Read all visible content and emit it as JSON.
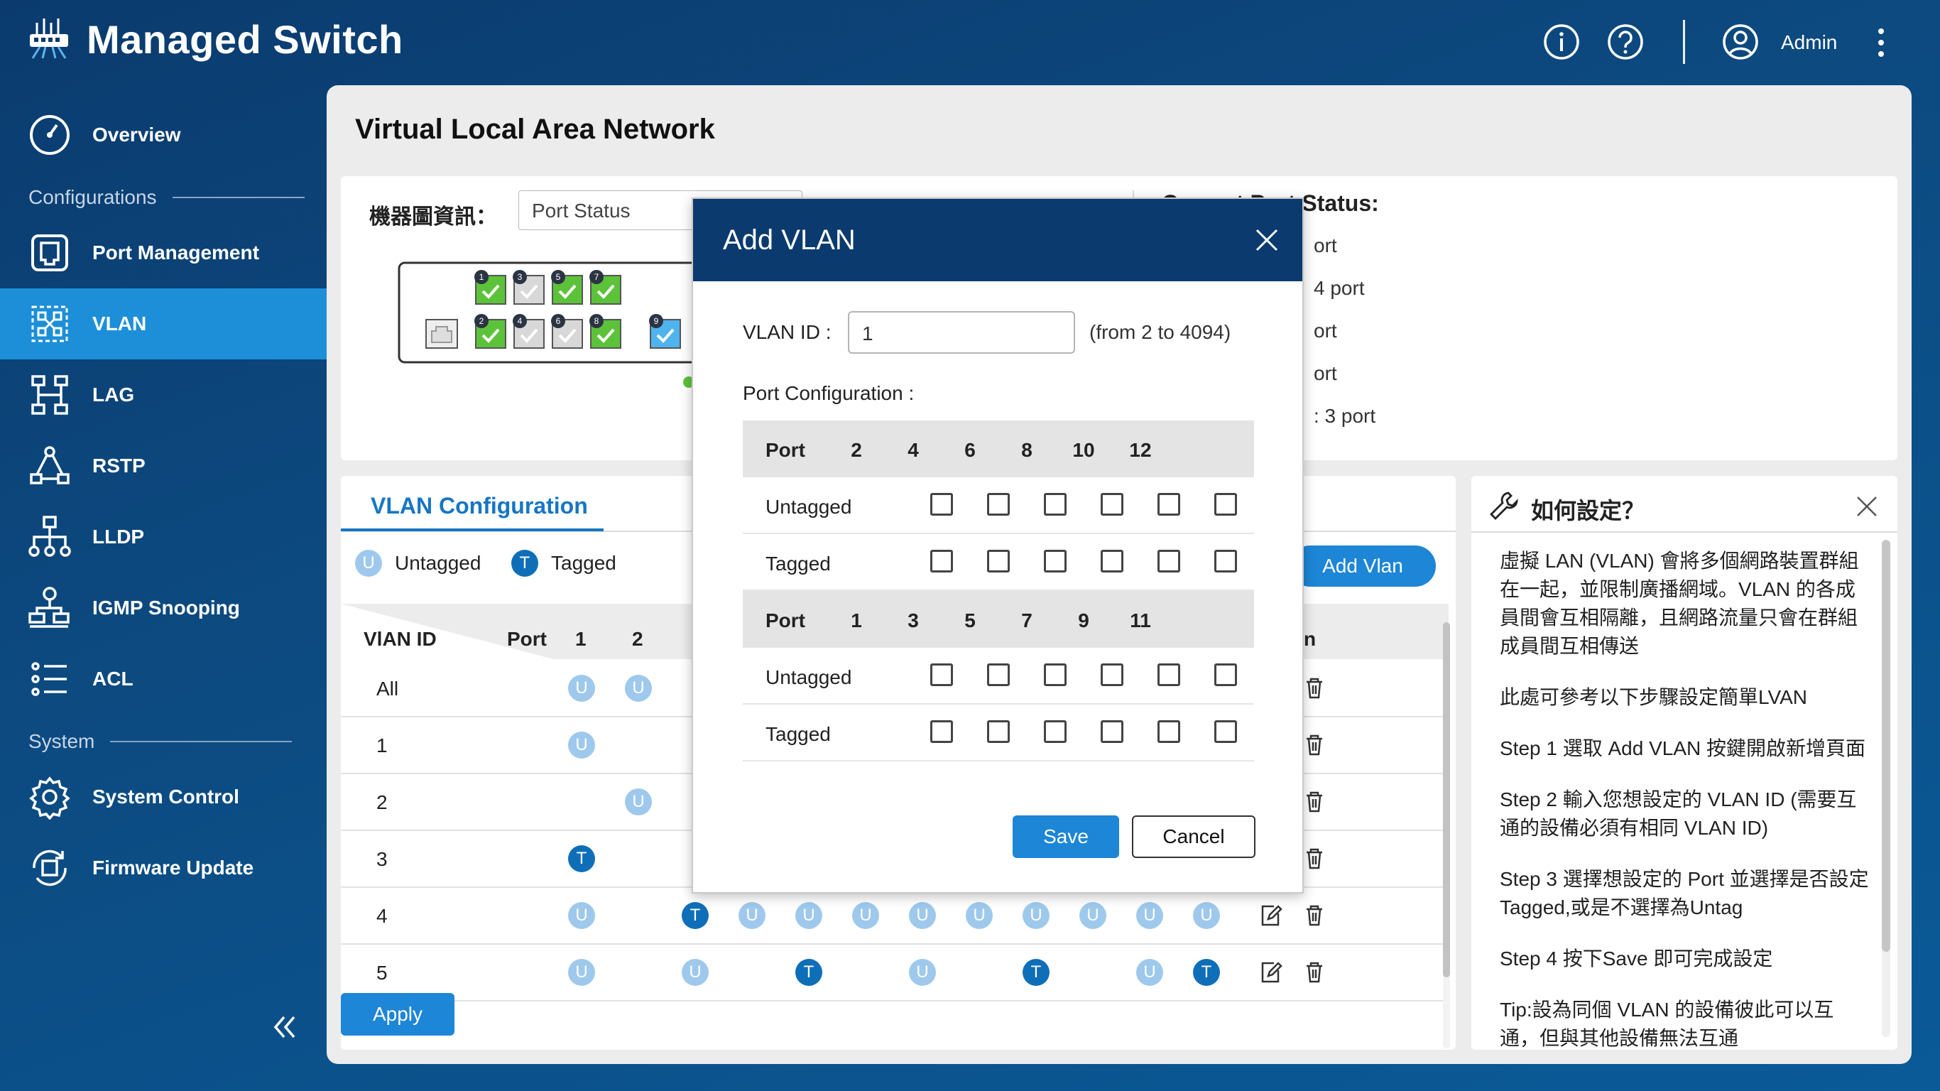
{
  "app": {
    "title": "Managed Switch",
    "admin_label": "Admin",
    "colors": {
      "accent": "#1d86d6",
      "navy": "#0b3a6e",
      "tagged": "#0f6eb8",
      "untagged": "#9ec9ec",
      "port_ok": "#5cc23a"
    }
  },
  "sidebar": {
    "items": [
      {
        "label": "Overview",
        "icon": "gauge-icon"
      },
      {
        "label": "Port Management",
        "icon": "port-icon"
      },
      {
        "label": "VLAN",
        "icon": "vlan-icon",
        "active": true
      },
      {
        "label": "LAG",
        "icon": "lag-icon"
      },
      {
        "label": "RSTP",
        "icon": "rstp-icon"
      },
      {
        "label": "LLDP",
        "icon": "lldp-icon"
      },
      {
        "label": "IGMP Snooping",
        "icon": "igmp-icon"
      },
      {
        "label": "ACL",
        "icon": "acl-icon"
      },
      {
        "label": "System Control",
        "icon": "gear-icon"
      },
      {
        "label": "Firmware Update",
        "icon": "firmware-icon"
      }
    ],
    "sections": {
      "configurations": "Configurations",
      "system": "System"
    }
  },
  "main": {
    "title": "Virtual Local Area Network",
    "info": {
      "label": "機器圖資訊：",
      "select_value": "Port Status",
      "status_title": "Current Port Status:",
      "status_lines": [
        "ort",
        "4 port",
        "ort",
        "ort",
        ":   3 port"
      ],
      "port_numbers_top": [
        "1",
        "3",
        "5",
        "7"
      ],
      "port_numbers_bottom": [
        "2",
        "4",
        "6",
        "8"
      ],
      "port_extra": "9"
    },
    "vlan": {
      "tab_label": "VLAN Configuration",
      "legend_untagged_letter": "U",
      "legend_untagged": "Untagged",
      "legend_tagged_letter": "T",
      "legend_tagged": "Tagged",
      "add_button": "Add Vlan",
      "header": {
        "vlan_id": "VlAN ID",
        "port": "Port",
        "p1": "1",
        "p2": "2",
        "action": "n"
      },
      "rows": [
        {
          "vid": "All"
        },
        {
          "vid": "1"
        },
        {
          "vid": "2"
        },
        {
          "vid": "3"
        },
        {
          "vid": "4"
        },
        {
          "vid": "5"
        }
      ],
      "apply_button": "Apply"
    },
    "help": {
      "title": "如何設定？",
      "paragraphs": [
        "虛擬 LAN (VLAN) 會將多個網路裝置群組在一起，並限制廣播網域。VLAN 的各成員間會互相隔離，且網路流量只會在群組成員間互相傳送",
        "此處可參考以下步驟設定簡單LVAN",
        "Step 1 選取 Add VLAN 按鍵開啟新增頁面",
        "Step 2 輸入您想設定的 VLAN ID (需要互通的設備必須有相同 VLAN ID)",
        "Step 3 選擇想設定的 Port 並選擇是否設定Tagged,或是不選擇為Untag",
        "Step 4 按下Save 即可完成設定",
        "Tip:設為同個 VLAN 的設備彼此可以互通，但與其他設備無法互通"
      ]
    }
  },
  "modal": {
    "title": "Add VLAN",
    "vlan_id_label": "VLAN ID :",
    "vlan_id_value": "1",
    "vlan_id_range": "(from 2 to 4094)",
    "port_config_label": "Port Configuration :",
    "port_header": "Port",
    "untagged": "Untagged",
    "tagged": "Tagged",
    "even_ports": [
      "2",
      "4",
      "6",
      "8",
      "10",
      "12"
    ],
    "odd_ports": [
      "1",
      "3",
      "5",
      "7",
      "9",
      "11"
    ],
    "save": "Save",
    "cancel": "Cancel"
  }
}
